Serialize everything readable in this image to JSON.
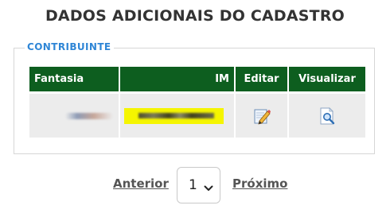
{
  "page": {
    "title": "DADOS ADICIONAIS DO CADASTRO"
  },
  "section": {
    "legend": "CONTRIBUINTE"
  },
  "table": {
    "headers": {
      "fantasia": "Fantasia",
      "im": "IM",
      "editar": "Editar",
      "visualizar": "Visualizar"
    },
    "rows": [
      {
        "fantasia": "",
        "im": ""
      }
    ]
  },
  "pagination": {
    "prev_label": "Anterior",
    "current_page": "1",
    "next_label": "Próximo"
  },
  "icons": {
    "edit": "pencil-edit-icon",
    "view": "magnifier-view-icon",
    "dropdown": "chevron-down-icon"
  },
  "colors": {
    "header_bg": "#0d5e1f",
    "legend": "#2f86d6",
    "redaction": "#f5f500"
  }
}
